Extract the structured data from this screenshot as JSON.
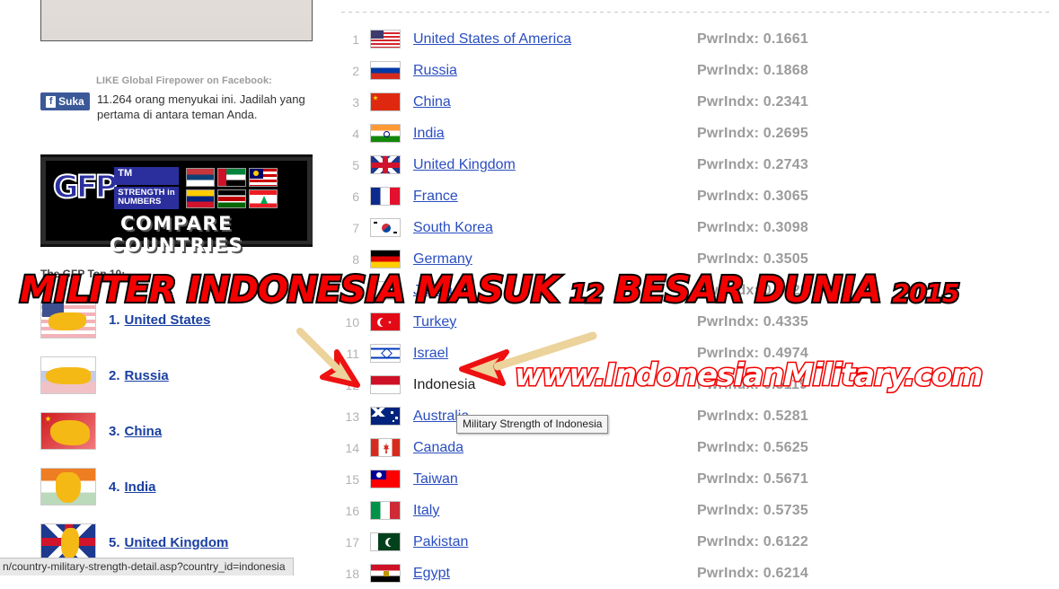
{
  "sidebar": {
    "facebook": {
      "caption": "LIKE Global Firepower on Facebook:",
      "like_label": "Suka",
      "fb_icon": "facebook-f-icon",
      "text": "11.264 orang menyukai ini. Jadilah yang pertama di antara teman Anda."
    },
    "banner": {
      "logo": "GFP",
      "tm": "TM",
      "strength_line1": "STRENGTH in",
      "strength_line2": "NUMBERS",
      "compare": "COMPARE COUNTRIES",
      "flags": [
        "serbia-flag",
        "uae-flag",
        "malaysia-flag",
        "venezuela-flag",
        "kenya-flag",
        "lebanon-flag"
      ]
    },
    "top10_heading": "The GFP Top 10:",
    "top10": [
      {
        "rank": "1.",
        "name": "United States",
        "thumb": "usa-map-thumbnail"
      },
      {
        "rank": "2.",
        "name": "Russia",
        "thumb": "russia-map-thumbnail"
      },
      {
        "rank": "3.",
        "name": "China",
        "thumb": "china-map-thumbnail"
      },
      {
        "rank": "4.",
        "name": "India",
        "thumb": "india-map-thumbnail"
      },
      {
        "rank": "5.",
        "name": "United Kingdom",
        "thumb": "uk-map-thumbnail"
      }
    ]
  },
  "ranking": {
    "pwr_prefix": "PwrIndx: ",
    "rows": [
      {
        "rank": "1",
        "country": "United States of America",
        "pwr": "PwrIndx: 0.1661",
        "flag": "usa-flag",
        "linked": true
      },
      {
        "rank": "2",
        "country": "Russia",
        "pwr": "PwrIndx: 0.1868",
        "flag": "russia-flag",
        "linked": true
      },
      {
        "rank": "3",
        "country": "China",
        "pwr": "PwrIndx: 0.2341",
        "flag": "china-flag",
        "linked": true
      },
      {
        "rank": "4",
        "country": "India",
        "pwr": "PwrIndx: 0.2695",
        "flag": "india-flag",
        "linked": true
      },
      {
        "rank": "5",
        "country": "United Kingdom",
        "pwr": "PwrIndx: 0.2743",
        "flag": "uk-flag",
        "linked": true
      },
      {
        "rank": "6",
        "country": "France",
        "pwr": "PwrIndx: 0.3065",
        "flag": "france-flag",
        "linked": true
      },
      {
        "rank": "7",
        "country": "South Korea",
        "pwr": "PwrIndx: 0.3098",
        "flag": "south-korea-flag",
        "linked": true
      },
      {
        "rank": "8",
        "country": "Germany",
        "pwr": "PwrIndx: 0.3505",
        "flag": "germany-flag",
        "linked": true
      },
      {
        "rank": "9",
        "country": "Japan",
        "pwr": "PwrIndx: 0.4025",
        "flag": "japan-flag",
        "linked": true
      },
      {
        "rank": "10",
        "country": "Turkey",
        "pwr": "PwrIndx: 0.4335",
        "flag": "turkey-flag",
        "linked": true
      },
      {
        "rank": "11",
        "country": "Israel",
        "pwr": "PwrIndx: 0.4974",
        "flag": "israel-flag",
        "linked": true
      },
      {
        "rank": "12",
        "country": "Indonesia",
        "pwr": "PwrIndx: 0.5119",
        "flag": "indonesia-flag",
        "linked": false
      },
      {
        "rank": "13",
        "country": "Australia",
        "pwr": "PwrIndx: 0.5281",
        "flag": "australia-flag",
        "linked": true
      },
      {
        "rank": "14",
        "country": "Canada",
        "pwr": "PwrIndx: 0.5625",
        "flag": "canada-flag",
        "linked": true
      },
      {
        "rank": "15",
        "country": "Taiwan",
        "pwr": "PwrIndx: 0.5671",
        "flag": "taiwan-flag",
        "linked": true
      },
      {
        "rank": "16",
        "country": "Italy",
        "pwr": "PwrIndx: 0.5735",
        "flag": "italy-flag",
        "linked": true
      },
      {
        "rank": "17",
        "country": "Pakistan",
        "pwr": "PwrIndx: 0.6122",
        "flag": "pakistan-flag",
        "linked": true
      },
      {
        "rank": "18",
        "country": "Egypt",
        "pwr": "PwrIndx: 0.6214",
        "flag": "egypt-flag",
        "linked": true
      }
    ]
  },
  "overlay": {
    "headline_1": "MILITER INDONESIA MASUK",
    "headline_number": "12",
    "headline_2": "BESAR DUNIA",
    "headline_year": "2015",
    "watermark": "www.IndonesianMilitary.com",
    "arrows": [
      "red-arrow-down-right",
      "red-arrow-left"
    ]
  },
  "tooltip": {
    "text": "Military Strength of Indonesia"
  },
  "statusbar": {
    "url": "n/country-military-strength-detail.asp?country_id=indonesia"
  },
  "colors": {
    "link": "#2a4ec0",
    "rank_grey": "#b3b3b3",
    "pwr_grey": "#9b9b9b",
    "overlay_red": "#f40000",
    "gfp_blue": "#2b2f9e",
    "facebook_blue": "#3b5998"
  }
}
